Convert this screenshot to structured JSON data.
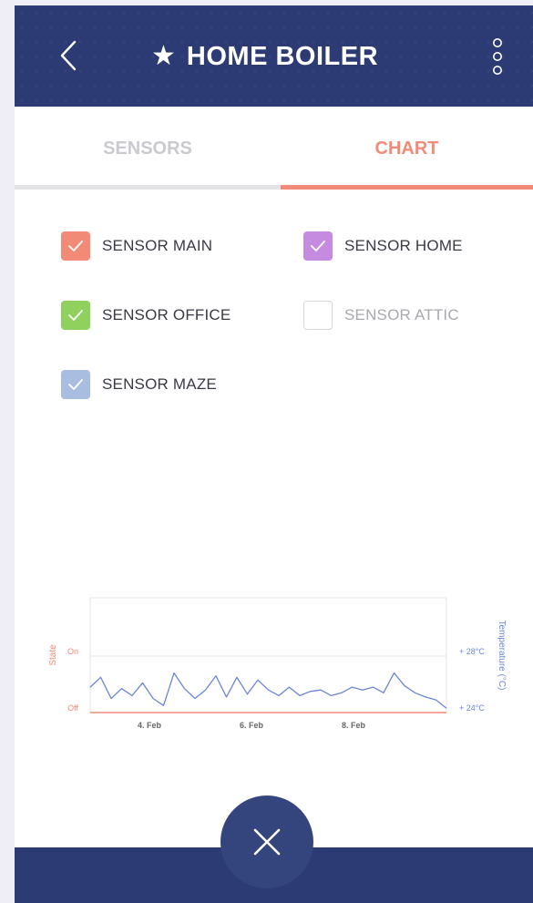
{
  "header": {
    "title": "HOME BOILER",
    "star_icon": "star-icon",
    "back_icon": "chevron-left-icon",
    "more_icon": "more-vertical-icon"
  },
  "tabs": [
    {
      "label": "SENSORS",
      "active": false
    },
    {
      "label": "CHART",
      "active": true
    }
  ],
  "sensors": [
    {
      "label": "SENSOR MAIN",
      "checked": true,
      "color": "#f28a78"
    },
    {
      "label": "SENSOR HOME",
      "checked": true,
      "color": "#c58be0"
    },
    {
      "label": "SENSOR OFFICE",
      "checked": true,
      "color": "#8fd15c"
    },
    {
      "label": "SENSOR ATTIC",
      "checked": false,
      "color": "#d6d6da"
    },
    {
      "label": "SENSOR MAZE",
      "checked": true,
      "color": "#a9bde0"
    }
  ],
  "chart_data": {
    "type": "line",
    "left_axis": {
      "label": "State",
      "ticks": [
        "On",
        "Off"
      ],
      "color": "#f28a78"
    },
    "right_axis": {
      "label": "Temperature (°C)",
      "ticks": [
        "+ 28°C",
        "+ 24°C"
      ],
      "range": [
        24,
        28
      ],
      "color": "#6a86d9"
    },
    "x_ticks": [
      "4. Feb",
      "6. Feb",
      "8. Feb"
    ],
    "series": [
      {
        "color": "#6a86d9",
        "x": [
          3.0,
          3.2,
          3.4,
          3.6,
          3.8,
          4.0,
          4.2,
          4.4,
          4.6,
          4.8,
          5.0,
          5.2,
          5.4,
          5.6,
          5.8,
          6.0,
          6.2,
          6.4,
          6.6,
          6.8,
          7.0,
          7.2,
          7.4,
          7.6,
          7.8,
          8.0,
          8.2,
          8.4,
          8.6,
          8.8,
          9.0,
          9.2,
          9.4,
          9.6,
          9.8
        ],
        "values": [
          25.8,
          26.5,
          25.0,
          25.7,
          25.2,
          26.1,
          25.0,
          24.5,
          26.8,
          25.7,
          25.0,
          25.6,
          26.6,
          25.1,
          26.5,
          25.3,
          26.3,
          25.6,
          25.2,
          25.8,
          25.2,
          25.5,
          25.6,
          25.2,
          25.4,
          25.8,
          25.6,
          25.8,
          25.4,
          26.8,
          25.9,
          25.4,
          25.1,
          24.9,
          24.3
        ]
      },
      {
        "color": "#f28a78",
        "x": [
          3.0,
          9.8
        ],
        "values": [
          24.0,
          24.0
        ]
      }
    ]
  },
  "footer": {
    "close_icon": "close-icon"
  }
}
